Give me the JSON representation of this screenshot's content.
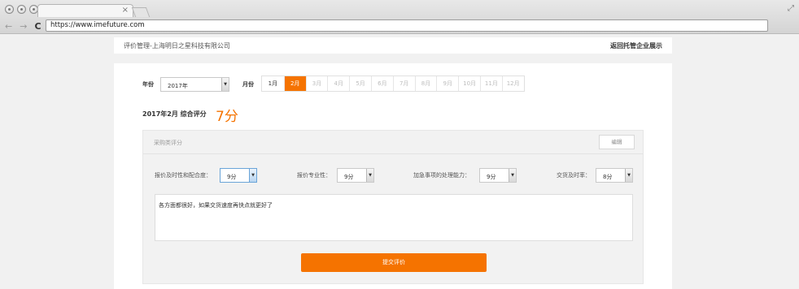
{
  "browser": {
    "url": "https://www.imefuture.com",
    "tab_close": "×",
    "expand_icon": "⤢",
    "nav": {
      "back": "←",
      "forward": "→",
      "reload": "C"
    }
  },
  "header": {
    "title": "评价管理-上海明日之星科技有限公司",
    "back_link": "返回托管企业展示"
  },
  "filters": {
    "year_label": "年份",
    "year_value": "2017年",
    "month_label": "月份",
    "months": [
      "1月",
      "2月",
      "3月",
      "4月",
      "5月",
      "6月",
      "7月",
      "8月",
      "9月",
      "10月",
      "11月",
      "12月"
    ],
    "selected_month": "2月"
  },
  "summary": {
    "text": "2017年2月  综合评分",
    "score": "7分"
  },
  "section": {
    "title": "采购类评分",
    "edit_label": "编辑",
    "fields": [
      {
        "label": "报价及时性和配合度：",
        "value": "9分"
      },
      {
        "label": "报价专业性：",
        "value": "9分"
      },
      {
        "label": "加急事项的处理能力：",
        "value": "9分"
      },
      {
        "label": "交货及时率：",
        "value": "8分"
      }
    ],
    "comment": "各方面都很好，如果交货速度再快点就更好了",
    "submit_label": "提交评价"
  },
  "colors": {
    "accent": "#f57300"
  }
}
